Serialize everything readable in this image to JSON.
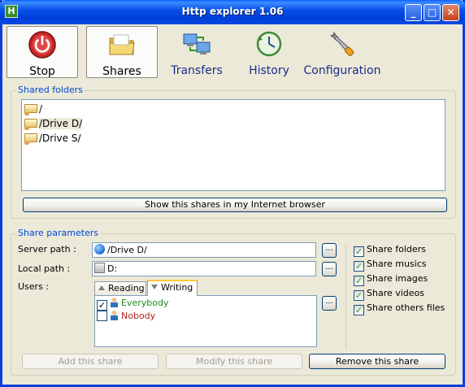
{
  "window": {
    "title": "Http explorer 1.06",
    "icon_letter": "H"
  },
  "toolbar": {
    "items": [
      {
        "label": "Stop",
        "icon": "power-icon"
      },
      {
        "label": "Shares",
        "icon": "folder-icon"
      },
      {
        "label": "Transfers",
        "icon": "network-icon"
      },
      {
        "label": "History",
        "icon": "history-icon"
      },
      {
        "label": "Configuration",
        "icon": "wrench-icon"
      }
    ]
  },
  "shared_folders": {
    "legend": "Shared folders",
    "items": [
      "/",
      "/Drive D/",
      "/Drive S/"
    ],
    "selected_index": 1,
    "browser_button": "Show this shares in my Internet browser"
  },
  "share_parameters": {
    "legend": "Share parameters",
    "server_path_label": "Server path :",
    "server_path_value": "/Drive D/",
    "local_path_label": "Local path :",
    "local_path_value": "D:",
    "users_label": "Users :",
    "browse_label": "...",
    "tabs": [
      {
        "label": "Reading",
        "active": false
      },
      {
        "label": "Writing",
        "active": true
      }
    ],
    "users": [
      {
        "name": "Everybody",
        "checked": true,
        "color": "#1f8a1f"
      },
      {
        "name": "Nobody",
        "checked": false,
        "color": "#b22222"
      }
    ],
    "options": [
      {
        "label": "Share folders",
        "checked": true
      },
      {
        "label": "Share musics",
        "checked": true
      },
      {
        "label": "Share images",
        "checked": true
      },
      {
        "label": "Share videos",
        "checked": true
      },
      {
        "label": "Share others files",
        "checked": true
      }
    ]
  },
  "actions": {
    "add": "Add this share",
    "modify": "Modify this share",
    "remove": "Remove this share"
  }
}
